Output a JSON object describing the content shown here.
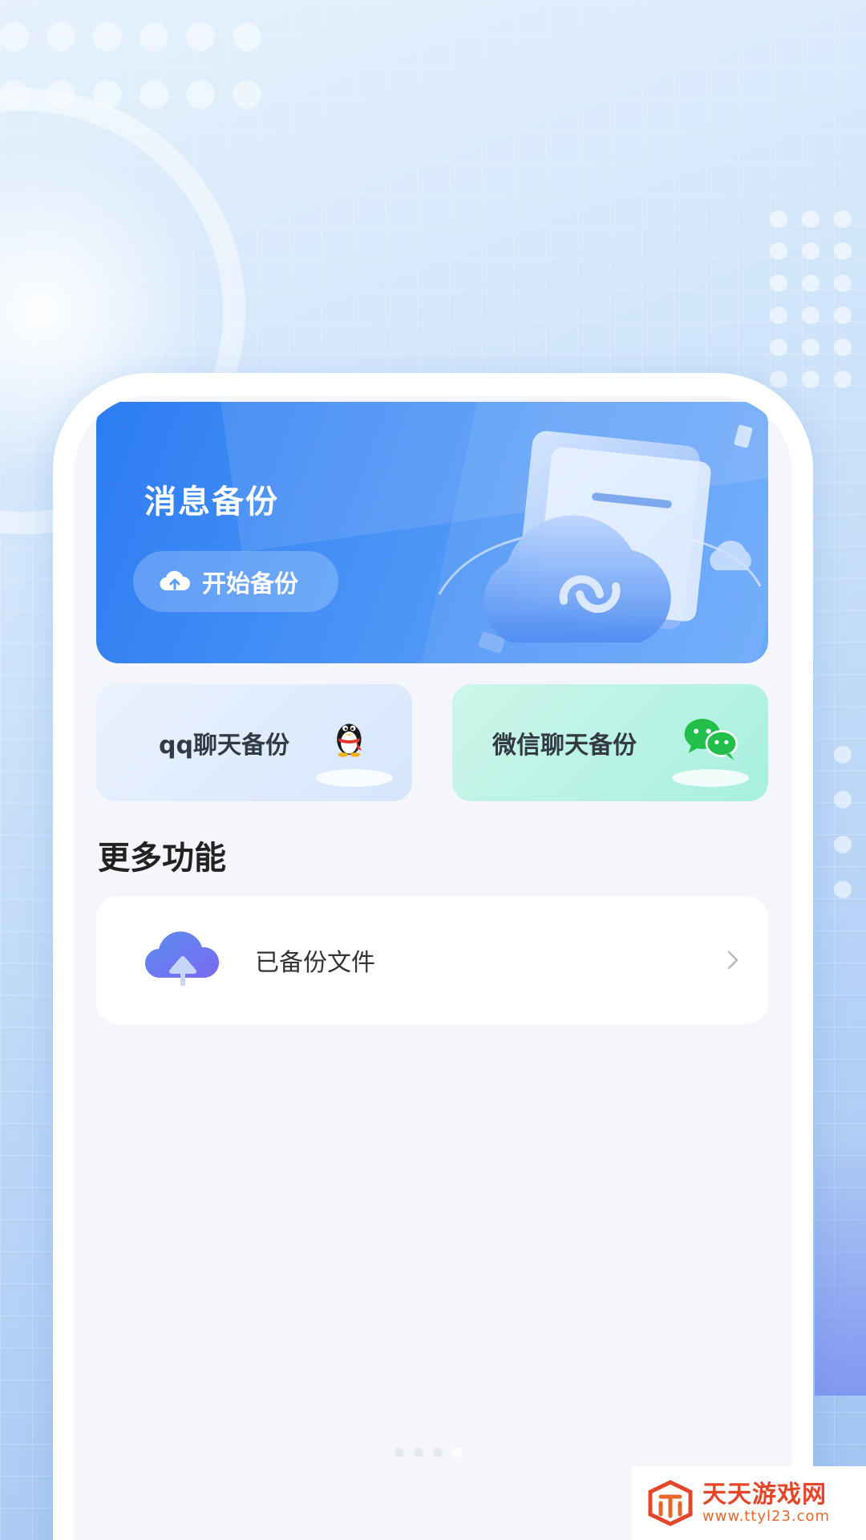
{
  "hero": {
    "title": "消息备份",
    "button_label": "开始备份",
    "button_icon": "cloud-upload-icon"
  },
  "chat_cards": {
    "qq": {
      "label": "qq聊天备份",
      "icon": "qq-penguin-icon"
    },
    "wechat": {
      "label": "微信聊天备份",
      "icon": "wechat-icon"
    }
  },
  "more_features": {
    "title": "更多功能",
    "items": [
      {
        "label": "已备份文件",
        "icon": "cloud-upload-large-icon"
      }
    ]
  },
  "watermark": {
    "name": "天天游戏网",
    "url": "www.ttyl23.com"
  },
  "colors": {
    "hero_blue": "#2c7cf2",
    "qq_card": "#d6e6fd",
    "wechat_card": "#a8f0de",
    "wechat_green": "#22c04a",
    "page_bg": "#f4f6fb"
  }
}
